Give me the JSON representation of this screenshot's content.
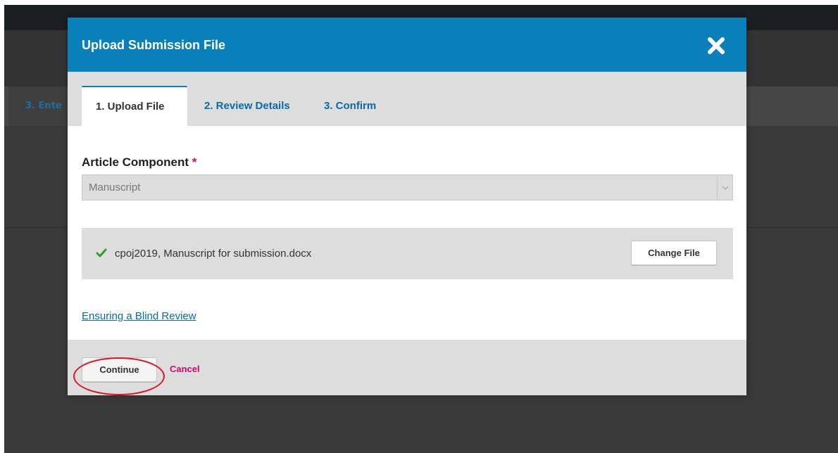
{
  "background": {
    "partial_tab_label": "3. Ente"
  },
  "modal": {
    "title": "Upload Submission File",
    "close_icon": "close-icon"
  },
  "tabs": [
    {
      "label": "1. Upload File",
      "active": true
    },
    {
      "label": "2. Review Details",
      "active": false
    },
    {
      "label": "3. Confirm",
      "active": false
    }
  ],
  "form": {
    "component_label": "Article Component",
    "required_mark": "*",
    "component_value": "Manuscript"
  },
  "file": {
    "name": "cpoj2019, Manuscript for submission.docx",
    "status_icon": "check-icon",
    "change_label": "Change File"
  },
  "links": {
    "blind_review": "Ensuring a Blind Review"
  },
  "footer": {
    "continue_label": "Continue",
    "cancel_label": "Cancel"
  },
  "colors": {
    "header": "#0a80ba",
    "accent_link": "#0a6aa8",
    "required": "#d00a6c",
    "annotation": "#e0141e"
  }
}
